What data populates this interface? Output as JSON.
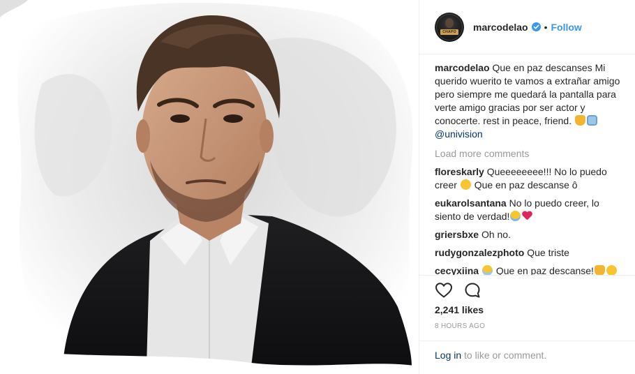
{
  "header": {
    "username": "marcodelao",
    "separator": "•",
    "follow_label": "Follow",
    "avatar_text": "CHAPO"
  },
  "caption": {
    "username": "marcodelao",
    "text": "Que en paz descanses Mi querido wuerito te vamos a extrañar amigo pero siempre me quedará la pantalla para verte amigo gracias por ser actor y conocerte. rest in peace, friend.",
    "mention": "@univision"
  },
  "load_more": "Load more comments",
  "comments": [
    {
      "username": "floreskarly",
      "text_before": "Queeeeeeee!!! No lo puedo creer",
      "text_after": "Que en paz descanse ô"
    },
    {
      "username": "eukarolsantana",
      "text_before": "No lo puedo creer, lo siento de verdad!",
      "text_after": ""
    },
    {
      "username": "griersbxe",
      "text_before": "Oh no.",
      "text_after": ""
    },
    {
      "username": "rudygonzalezphoto",
      "text_before": "Que triste",
      "text_after": ""
    },
    {
      "username": "cecyxiina",
      "text_before": "",
      "text_after": "Que en paz descanse!"
    }
  ],
  "likes": "2,241 likes",
  "timestamp": "8 HOURS AGO",
  "footer": {
    "login_label": "Log in",
    "rest": "to like or comment."
  },
  "icons": {
    "like": "heart-icon",
    "comment": "comment-icon",
    "verified": "verified-badge-icon"
  },
  "colors": {
    "link_blue": "#3897f0",
    "mention_blue": "#003569",
    "muted": "#999999",
    "text": "#262626"
  }
}
